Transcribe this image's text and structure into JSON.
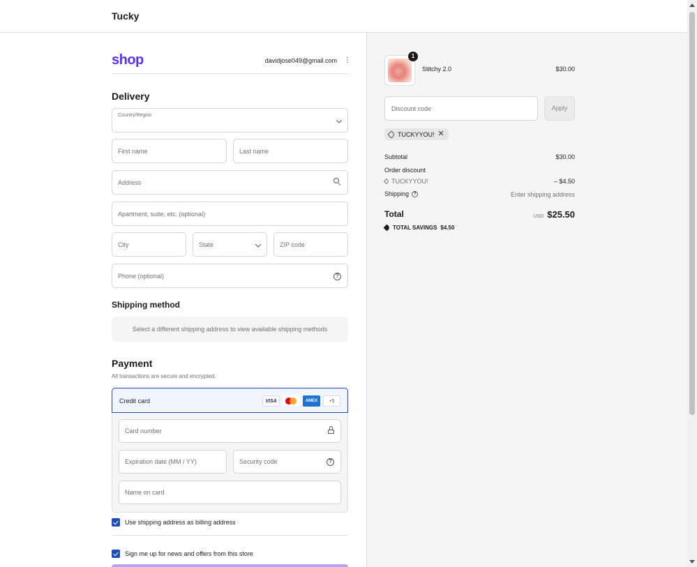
{
  "header": {
    "store_name": "Tucky"
  },
  "account": {
    "logo": "shop",
    "email": "davidjose049@gmail.com",
    "menu_glyph": "⋮"
  },
  "delivery": {
    "title": "Delivery",
    "country_label": "Country/Region",
    "first_name": "First name",
    "last_name": "Last name",
    "address": "Address",
    "apartment": "Apartment, suite, etc. (optional)",
    "city": "City",
    "state": "State",
    "zip": "ZIP code",
    "phone": "Phone (optional)"
  },
  "shipping": {
    "title": "Shipping method",
    "message": "Select a different shipping address to view available shipping methods"
  },
  "payment": {
    "title": "Payment",
    "subtitle": "All transactions are secure and encrypted.",
    "method": "Credit card",
    "cards": {
      "visa": "VISA",
      "amex": "AMEX",
      "more": "+5"
    },
    "card_number": "Card number",
    "expiration": "Expiration date (MM / YY)",
    "security": "Security code",
    "name_on_card": "Name on card",
    "billing_same": "Use shipping address as billing address",
    "newsletter": "Sign me up for news and offers from this store"
  },
  "summary": {
    "item": {
      "name": "Stitchy 2.0",
      "price": "$30.00",
      "quantity": "1"
    },
    "discount_placeholder": "Discount code",
    "apply": "Apply",
    "applied_code": "TUCKYYOU!",
    "subtotal_label": "Subtotal",
    "subtotal": "$30.00",
    "order_discount_label": "Order discount",
    "discount_code": "TUCKYYOU!",
    "discount_amount": "– $4.50",
    "shipping_label": "Shipping",
    "shipping_value": "Enter shipping address",
    "total_label": "Total",
    "currency": "USD",
    "total": "$25.50",
    "savings_label": "TOTAL SAVINGS",
    "savings": "$4.50"
  },
  "colors": {
    "shop_brand": "#5a31f4",
    "accent": "#1f4db5"
  }
}
